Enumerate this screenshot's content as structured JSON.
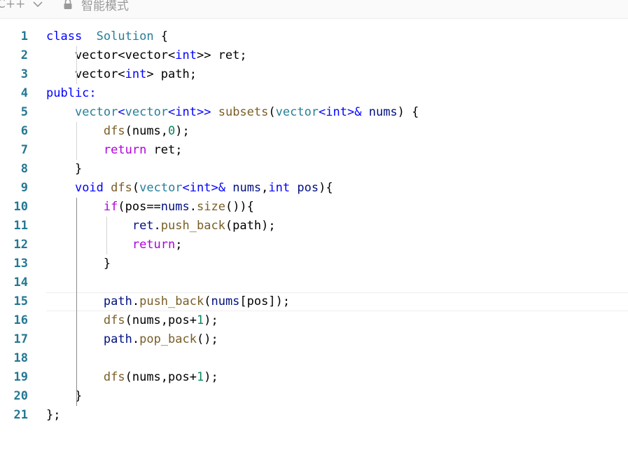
{
  "toolbar": {
    "language": "C++",
    "mode_label": "智能模式"
  },
  "editor": {
    "theme_colors": {
      "keyword": "#0000ff",
      "type": "#267f99",
      "control": "#af00db",
      "function": "#795e26",
      "variable": "#001080",
      "number": "#098658",
      "line_number": "#237893"
    },
    "current_line": 15,
    "lines": [
      {
        "n": "1",
        "tokens": [
          [
            "kw",
            "class"
          ],
          [
            "",
            "  "
          ],
          [
            "ty",
            "Solution"
          ],
          [
            "",
            " {"
          ]
        ]
      },
      {
        "n": "2",
        "tokens": [
          [
            "",
            "    vector<vector<"
          ],
          [
            "kw",
            "int"
          ],
          [
            "",
            ">> ret;"
          ]
        ]
      },
      {
        "n": "3",
        "tokens": [
          [
            "",
            "    vector<"
          ],
          [
            "kw",
            "int"
          ],
          [
            "",
            "> path;"
          ]
        ]
      },
      {
        "n": "4",
        "tokens": [
          [
            "kw",
            "public"
          ],
          [
            "kw",
            ":"
          ]
        ]
      },
      {
        "n": "5",
        "tokens": [
          [
            "",
            "    "
          ],
          [
            "ty",
            "vector"
          ],
          [
            "kw",
            "<"
          ],
          [
            "ty",
            "vector"
          ],
          [
            "kw",
            "<int>>"
          ],
          [
            "",
            " "
          ],
          [
            "fn",
            "subsets"
          ],
          [
            "",
            "("
          ],
          [
            "ty",
            "vector"
          ],
          [
            "kw",
            "<int>&"
          ],
          [
            "",
            " "
          ],
          [
            "vr",
            "nums"
          ],
          [
            "",
            ") {"
          ]
        ]
      },
      {
        "n": "6",
        "tokens": [
          [
            "",
            "        "
          ],
          [
            "fn",
            "dfs"
          ],
          [
            "",
            "(nums,"
          ],
          [
            "nm",
            "0"
          ],
          [
            "",
            ");"
          ]
        ]
      },
      {
        "n": "7",
        "tokens": [
          [
            "",
            "        "
          ],
          [
            "cf",
            "return"
          ],
          [
            "",
            " ret;"
          ]
        ]
      },
      {
        "n": "8",
        "tokens": [
          [
            "",
            "    }"
          ]
        ]
      },
      {
        "n": "9",
        "tokens": [
          [
            "",
            "    "
          ],
          [
            "kw",
            "void"
          ],
          [
            "",
            " "
          ],
          [
            "fn",
            "dfs"
          ],
          [
            "",
            "("
          ],
          [
            "ty",
            "vector"
          ],
          [
            "kw",
            "<int>&"
          ],
          [
            "",
            " "
          ],
          [
            "vr",
            "nums"
          ],
          [
            "",
            ","
          ],
          [
            "kw",
            "int"
          ],
          [
            "",
            " "
          ],
          [
            "vr",
            "pos"
          ],
          [
            "",
            "){"
          ]
        ]
      },
      {
        "n": "10",
        "tokens": [
          [
            "",
            "        "
          ],
          [
            "cf",
            "if"
          ],
          [
            "",
            "(pos=="
          ],
          [
            "vr",
            "nums"
          ],
          [
            "",
            "."
          ],
          [
            "fn",
            "size"
          ],
          [
            "",
            "()){"
          ]
        ]
      },
      {
        "n": "11",
        "tokens": [
          [
            "",
            "            "
          ],
          [
            "vr",
            "ret"
          ],
          [
            "",
            "."
          ],
          [
            "fn",
            "push_back"
          ],
          [
            "",
            "(path);"
          ]
        ]
      },
      {
        "n": "12",
        "tokens": [
          [
            "",
            "            "
          ],
          [
            "cf",
            "return"
          ],
          [
            "",
            ";"
          ]
        ]
      },
      {
        "n": "13",
        "tokens": [
          [
            "",
            "        }"
          ]
        ]
      },
      {
        "n": "14",
        "tokens": []
      },
      {
        "n": "15",
        "tokens": [
          [
            "",
            "        "
          ],
          [
            "vr",
            "path"
          ],
          [
            "",
            "."
          ],
          [
            "fn",
            "push_back"
          ],
          [
            "",
            "("
          ],
          [
            "vr",
            "nums"
          ],
          [
            "",
            "[pos]);"
          ]
        ]
      },
      {
        "n": "16",
        "tokens": [
          [
            "",
            "        "
          ],
          [
            "fn",
            "dfs"
          ],
          [
            "",
            "(nums,pos+"
          ],
          [
            "nm",
            "1"
          ],
          [
            "",
            ");"
          ]
        ]
      },
      {
        "n": "17",
        "tokens": [
          [
            "",
            "        "
          ],
          [
            "vr",
            "path"
          ],
          [
            "",
            "."
          ],
          [
            "fn",
            "pop_back"
          ],
          [
            "",
            "();"
          ]
        ]
      },
      {
        "n": "18",
        "tokens": []
      },
      {
        "n": "19",
        "tokens": [
          [
            "",
            "        "
          ],
          [
            "fn",
            "dfs"
          ],
          [
            "",
            "(nums,pos+"
          ],
          [
            "nm",
            "1"
          ],
          [
            "",
            ");"
          ]
        ]
      },
      {
        "n": "20",
        "tokens": [
          [
            "",
            "    }"
          ]
        ]
      },
      {
        "n": "21",
        "tokens": [
          [
            "",
            "};"
          ]
        ]
      }
    ]
  }
}
